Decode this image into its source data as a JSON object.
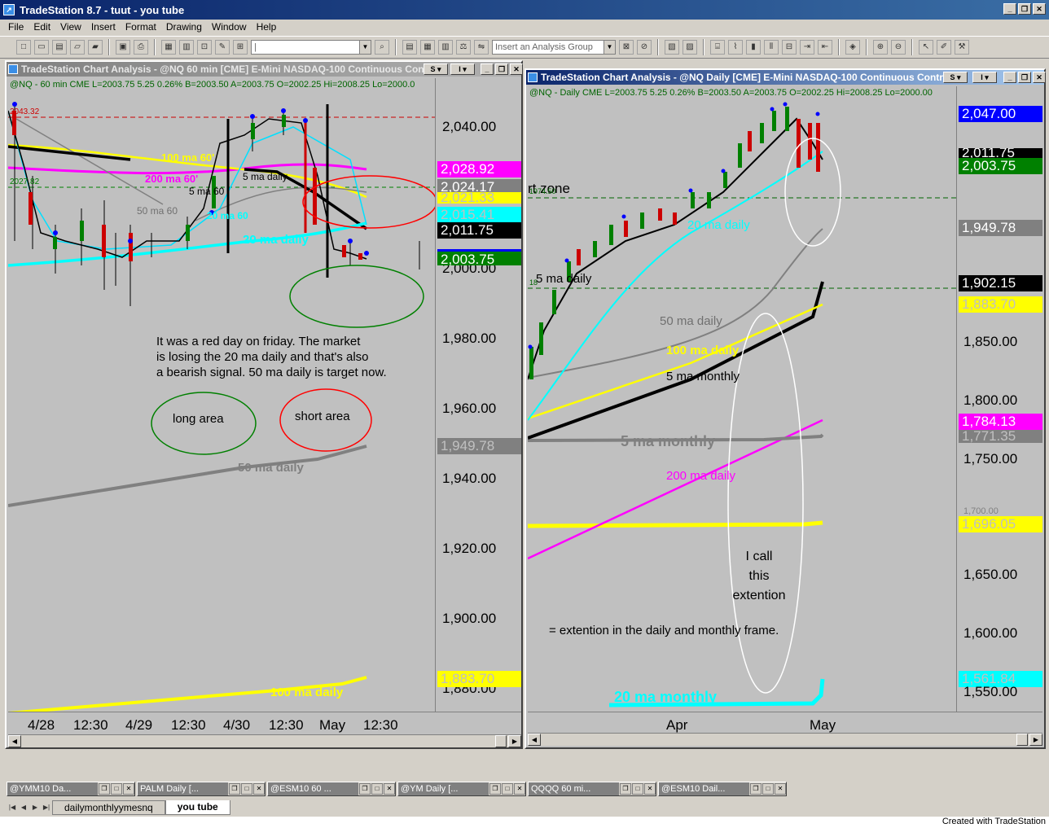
{
  "app": {
    "title": "TradeStation 8.7 - tuut - you tube"
  },
  "menu": [
    "File",
    "Edit",
    "View",
    "Insert",
    "Format",
    "Drawing",
    "Window",
    "Help"
  ],
  "toolbar": {
    "symbol_value": "|",
    "analysis_group_placeholder": "Insert an Analysis Group"
  },
  "left_chart": {
    "title": "TradeStation Chart Analysis - @NQ 60 min [CME] E-Mini NASDAQ-100 Continuous Con...",
    "info": "@NQ - 60 min  CME  L=2003.75  5.25  0.26%  B=2003.50  A=2003.75  O=2002.25  Hi=2008.25  Lo=2000.0",
    "price_axis": [
      "2,040.00",
      "2,000.00",
      "1,980.00",
      "1,960.00",
      "1,940.00",
      "1,920.00",
      "1,900.00",
      "1,880.00"
    ],
    "price_boxes": [
      {
        "label": "2,028.92",
        "bg": "#ff00ff",
        "fg": "#ffffff"
      },
      {
        "label": "2,024.17",
        "bg": "#808080",
        "fg": "#ffffff"
      },
      {
        "label": "2,021.33",
        "bg": "#ffff00",
        "fg": "#c0c0c0"
      },
      {
        "label": "2,015.41",
        "bg": "#00ffff",
        "fg": "#c0c0c0"
      },
      {
        "label": "2,011.75",
        "bg": "#000000",
        "fg": "#ffffff"
      },
      {
        "label": "2,003.75",
        "bg": "#008000",
        "fg": "#ffffff"
      },
      {
        "label": "1,949.78",
        "bg": "#808080",
        "fg": "#c0c0c0"
      },
      {
        "label": "1,883.70",
        "bg": "#ffff00",
        "fg": "#c0c0c0"
      }
    ],
    "time_axis": [
      "4/28",
      "12:30",
      "4/29",
      "12:30",
      "4/30",
      "12:30",
      "May",
      "12:30"
    ],
    "hline_labels": {
      "top_red": "2043.32",
      "green": "2027.82"
    },
    "labels": {
      "ma100_60": "100 ma 60'",
      "ma200_60": "200 ma 60'",
      "ma5_daily": "5 ma daily",
      "ma5_60": "5 ma 60",
      "ma50_60": "50 ma 60",
      "ma20_60": "20 ma 60",
      "ma20_daily": "20 ma daily",
      "ma50_daily": "50 ma daily",
      "ma100_daily": "100 ma daily"
    },
    "commentary": [
      "It was a red day on friday.  The market",
      "is losing the 20 ma daily and that's also",
      "a bearish signal.  50 ma daily is target now."
    ],
    "long_area": "long area",
    "short_area": "short area"
  },
  "right_chart": {
    "title": "TradeStation Chart Analysis - @NQ Daily [CME] E-Mini NASDAQ-100 Continuous Contra...",
    "info": "@NQ - Daily  CME  L=2003.75  5.25  0.26%  B=2003.50  A=2003.75  O=2002.25  Hi=2008.25  Lo=2000.00",
    "price_axis": [
      "1,850.00",
      "1,800.00",
      "1,750.00",
      "1,650.00",
      "1,600.00",
      "1,550.00"
    ],
    "price_boxes": [
      {
        "label": "2,047.00",
        "bg": "#0000ff",
        "fg": "#ffffff"
      },
      {
        "label": "2,011.75",
        "bg": "#000000",
        "fg": "#ffffff"
      },
      {
        "label": "2,003.75",
        "bg": "#008000",
        "fg": "#ffffff"
      },
      {
        "label": "1,949.78",
        "bg": "#808080",
        "fg": "#ffffff"
      },
      {
        "label": "1,902.15",
        "bg": "#000000",
        "fg": "#ffffff"
      },
      {
        "label": "1,883.70",
        "bg": "#ffff00",
        "fg": "#c0c0c0"
      },
      {
        "label": "1,784.13",
        "bg": "#ff00ff",
        "fg": "#ffffff"
      },
      {
        "label": "1,771.35",
        "bg": "#808080",
        "fg": "#c0c0c0"
      },
      {
        "label": "1,696.05",
        "bg": "#ffff00",
        "fg": "#c0c0c0"
      },
      {
        "label": "1,561.84",
        "bg": "#00ffff",
        "fg": "#c0c0c0"
      }
    ],
    "hidden_tick": "1,700.00",
    "time_axis": [
      "Apr",
      "May"
    ],
    "labels": {
      "zone": "rt  zone",
      "zone_price": "1974.50",
      "line_18": "18",
      "ma20_daily": "20 ma daily",
      "ma5_daily": "5 ma daily",
      "ma50_daily": "50 ma daily",
      "ma100_daily": "100 ma daily",
      "ma5_monthly_a": "5 ma monthly",
      "ma5_monthly_b": "5 ma monthly",
      "ma200_daily": "200 ma daily",
      "ma20_monthly": "20 ma monthly"
    },
    "call_text": [
      "I call",
      "this",
      "extention"
    ],
    "extension_note": "= extention in the daily and monthly frame."
  },
  "task_windows": [
    "@YMM10 Da...",
    "PALM Daily [...",
    "@ESM10 60 ...",
    "@YM Daily [...",
    "QQQQ 60 mi...",
    "@ESM10 Dail..."
  ],
  "sheet_tabs": [
    "dailymonthlyymesnq",
    "you tube"
  ],
  "status": "Created with TradeStation"
}
